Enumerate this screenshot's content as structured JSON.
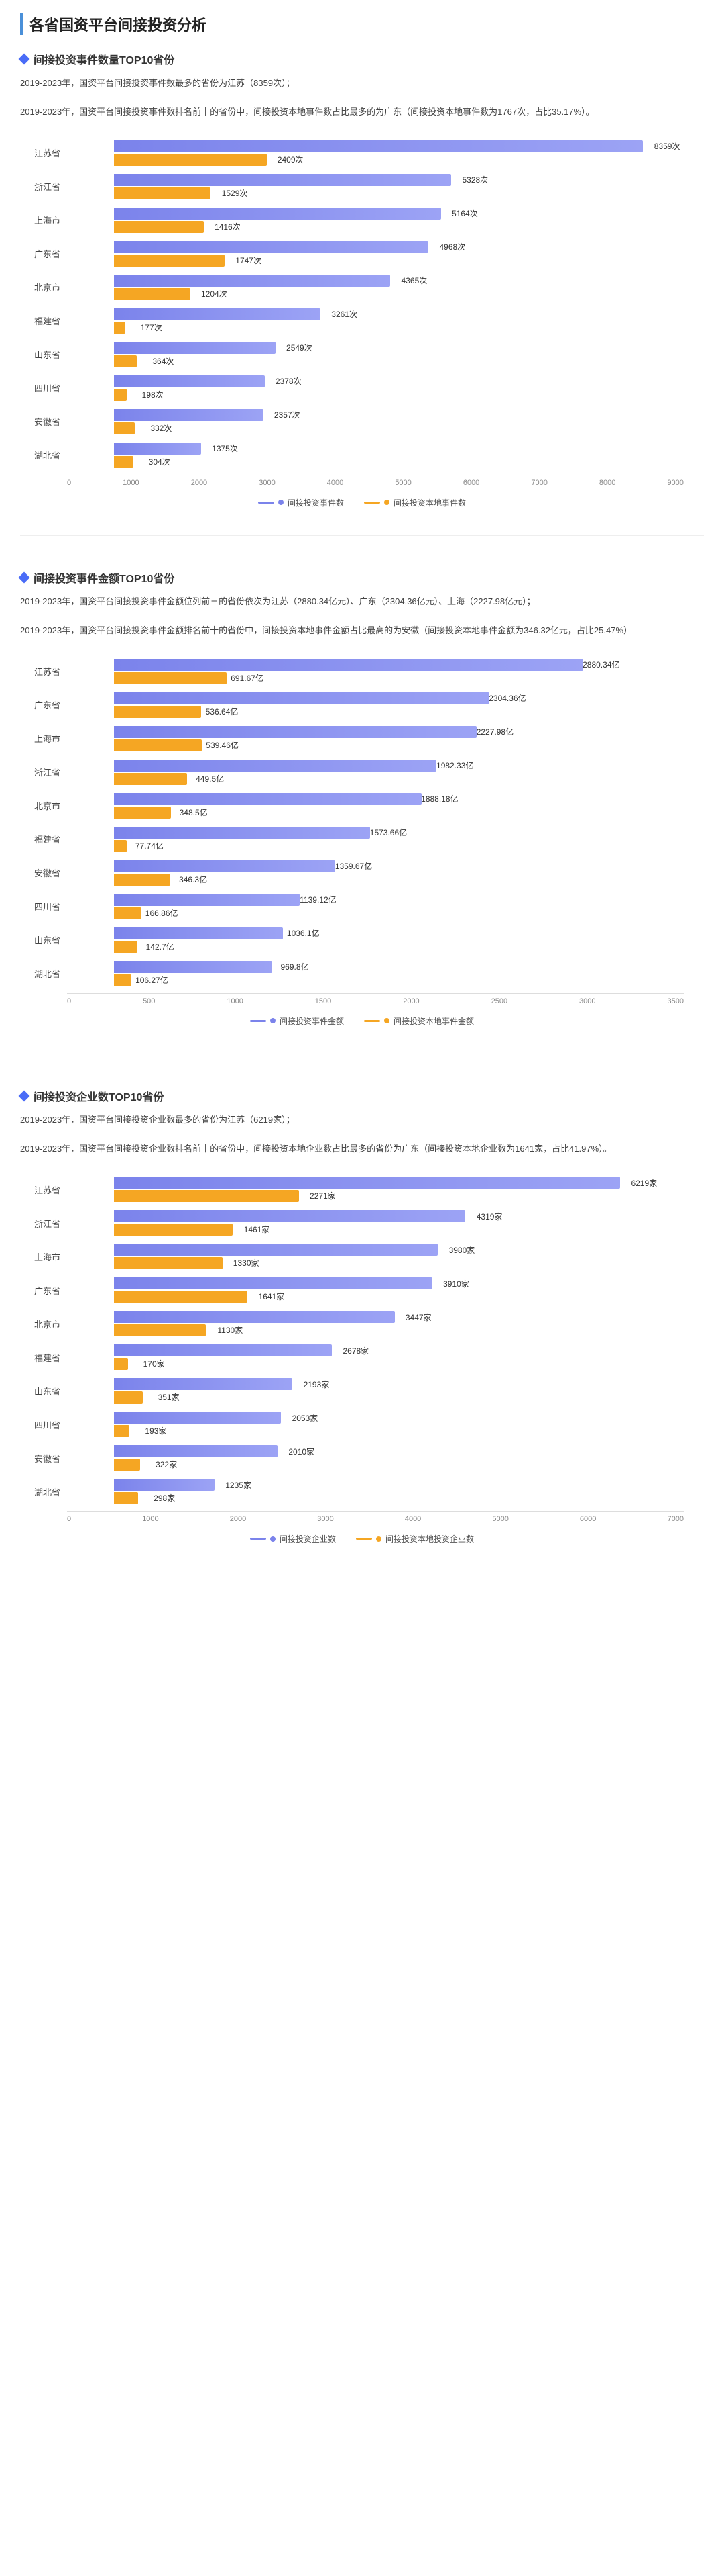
{
  "page": {
    "title": "各省国资平台间接投资分析"
  },
  "sections": [
    {
      "id": "count",
      "title": "间接投资事件数量TOP10省份",
      "desc1": "2019-2023年，国资平台间接投资事件数最多的省份为江苏（8359次）；",
      "desc2": "2019-2023年，国资平台间接投资事件数排名前十的省份中，间接投资本地事件数占比最多的为广东（间接投资本地事件数为1767次，占比35.17%）。",
      "legend": [
        "间接投资事件数",
        "间接投资本地事件数"
      ],
      "legendColors": [
        "#7B83EB",
        "#F5A623"
      ],
      "xTicks": [
        "0",
        "1000",
        "2000",
        "3000",
        "4000",
        "5000",
        "6000",
        "7000",
        "8000",
        "9000"
      ],
      "maxValue": 9000,
      "rows": [
        {
          "label": "江苏省",
          "v1": 8359,
          "v2": 2409,
          "v1Label": "8359次",
          "v2Label": "2409次"
        },
        {
          "label": "浙江省",
          "v1": 5328,
          "v2": 1529,
          "v1Label": "5328次",
          "v2Label": "1529次"
        },
        {
          "label": "上海市",
          "v1": 5164,
          "v2": 1416,
          "v1Label": "5164次",
          "v2Label": "1416次"
        },
        {
          "label": "广东省",
          "v1": 4968,
          "v2": 1747,
          "v1Label": "4968次",
          "v2Label": "1747次"
        },
        {
          "label": "北京市",
          "v1": 4365,
          "v2": 1204,
          "v1Label": "4365次",
          "v2Label": "1204次"
        },
        {
          "label": "福建省",
          "v1": 3261,
          "v2": 177,
          "v1Label": "3261次",
          "v2Label": "177次"
        },
        {
          "label": "山东省",
          "v1": 2549,
          "v2": 364,
          "v1Label": "2549次",
          "v2Label": "364次"
        },
        {
          "label": "四川省",
          "v1": 2378,
          "v2": 198,
          "v1Label": "2378次",
          "v2Label": "198次"
        },
        {
          "label": "安徽省",
          "v1": 2357,
          "v2": 332,
          "v1Label": "2357次",
          "v2Label": "332次"
        },
        {
          "label": "湖北省",
          "v1": 1375,
          "v2": 304,
          "v1Label": "1375次",
          "v2Label": "304次"
        }
      ]
    },
    {
      "id": "amount",
      "title": "间接投资事件金额TOP10省份",
      "desc1": "2019-2023年，国资平台间接投资事件金额位列前三的省份依次为江苏（2880.34亿元）、广东（2304.36亿元）、上海（2227.98亿元）；",
      "desc2": "2019-2023年，国资平台间接投资事件金额排名前十的省份中，间接投资本地事件金额占比最高的为安徽（间接投资本地事件金额为346.32亿元，占比25.47%）",
      "legend": [
        "间接投资事件金额",
        "间接投资本地事件金额"
      ],
      "legendColors": [
        "#7B83EB",
        "#F5A623"
      ],
      "xTicks": [
        "0",
        "500",
        "1000",
        "1500",
        "2000",
        "2500",
        "3000",
        "3500"
      ],
      "maxValue": 3500,
      "rows": [
        {
          "label": "江苏省",
          "v1": 2880.34,
          "v2": 691.67,
          "v1Label": "2880.34亿",
          "v2Label": "691.67亿"
        },
        {
          "label": "广东省",
          "v1": 2304.36,
          "v2": 536.64,
          "v1Label": "2304.36亿",
          "v2Label": "536.64亿"
        },
        {
          "label": "上海市",
          "v1": 2227.98,
          "v2": 539.46,
          "v1Label": "2227.98亿",
          "v2Label": "539.46亿"
        },
        {
          "label": "浙江省",
          "v1": 1982.33,
          "v2": 449.5,
          "v1Label": "1982.33亿",
          "v2Label": "449.5亿"
        },
        {
          "label": "北京市",
          "v1": 1888.18,
          "v2": 348.5,
          "v1Label": "1888.18亿",
          "v2Label": "348.5亿"
        },
        {
          "label": "福建省",
          "v1": 1573.66,
          "v2": 77.74,
          "v1Label": "1573.66亿",
          "v2Label": "77.74亿"
        },
        {
          "label": "安徽省",
          "v1": 1359.67,
          "v2": 346.3,
          "v1Label": "1359.67亿",
          "v2Label": "346.3亿"
        },
        {
          "label": "四川省",
          "v1": 1139.12,
          "v2": 166.86,
          "v1Label": "1139.12亿",
          "v2Label": "166.86亿"
        },
        {
          "label": "山东省",
          "v1": 1036.1,
          "v2": 142.7,
          "v1Label": "1036.1亿",
          "v2Label": "142.7亿"
        },
        {
          "label": "湖北省",
          "v1": 969.8,
          "v2": 106.27,
          "v1Label": "969.8亿",
          "v2Label": "106.27亿"
        }
      ]
    },
    {
      "id": "enterprise",
      "title": "间接投资企业数TOP10省份",
      "desc1": "2019-2023年，国资平台间接投资企业数最多的省份为江苏（6219家）；",
      "desc2": "2019-2023年，国资平台间接投资企业数排名前十的省份中，间接投资本地企业数占比最多的省份为广东（间接投资本地企业数为1641家，占比41.97%）。",
      "legend": [
        "间接投资企业数",
        "间接投资本地投资企业数"
      ],
      "legendColors": [
        "#7B83EB",
        "#F5A623"
      ],
      "xTicks": [
        "0",
        "1000",
        "2000",
        "3000",
        "4000",
        "5000",
        "6000",
        "7000"
      ],
      "maxValue": 7000,
      "rows": [
        {
          "label": "江苏省",
          "v1": 6219,
          "v2": 2271,
          "v1Label": "6219家",
          "v2Label": "2271家"
        },
        {
          "label": "浙江省",
          "v1": 4319,
          "v2": 1461,
          "v1Label": "4319家",
          "v2Label": "1461家"
        },
        {
          "label": "上海市",
          "v1": 3980,
          "v2": 1330,
          "v1Label": "3980家",
          "v2Label": "1330家"
        },
        {
          "label": "广东省",
          "v1": 3910,
          "v2": 1641,
          "v1Label": "3910家",
          "v2Label": "1641家"
        },
        {
          "label": "北京市",
          "v1": 3447,
          "v2": 1130,
          "v1Label": "3447家",
          "v2Label": "1130家"
        },
        {
          "label": "福建省",
          "v1": 2678,
          "v2": 170,
          "v1Label": "2678家",
          "v2Label": "170家"
        },
        {
          "label": "山东省",
          "v1": 2193,
          "v2": 351,
          "v1Label": "2193家",
          "v2Label": "351家"
        },
        {
          "label": "四川省",
          "v1": 2053,
          "v2": 193,
          "v1Label": "2053家",
          "v2Label": "193家"
        },
        {
          "label": "安徽省",
          "v1": 2010,
          "v2": 322,
          "v1Label": "2010家",
          "v2Label": "322家"
        },
        {
          "label": "湖北省",
          "v1": 1235,
          "v2": 298,
          "v1Label": "1235家",
          "v2Label": "298家"
        }
      ]
    }
  ]
}
